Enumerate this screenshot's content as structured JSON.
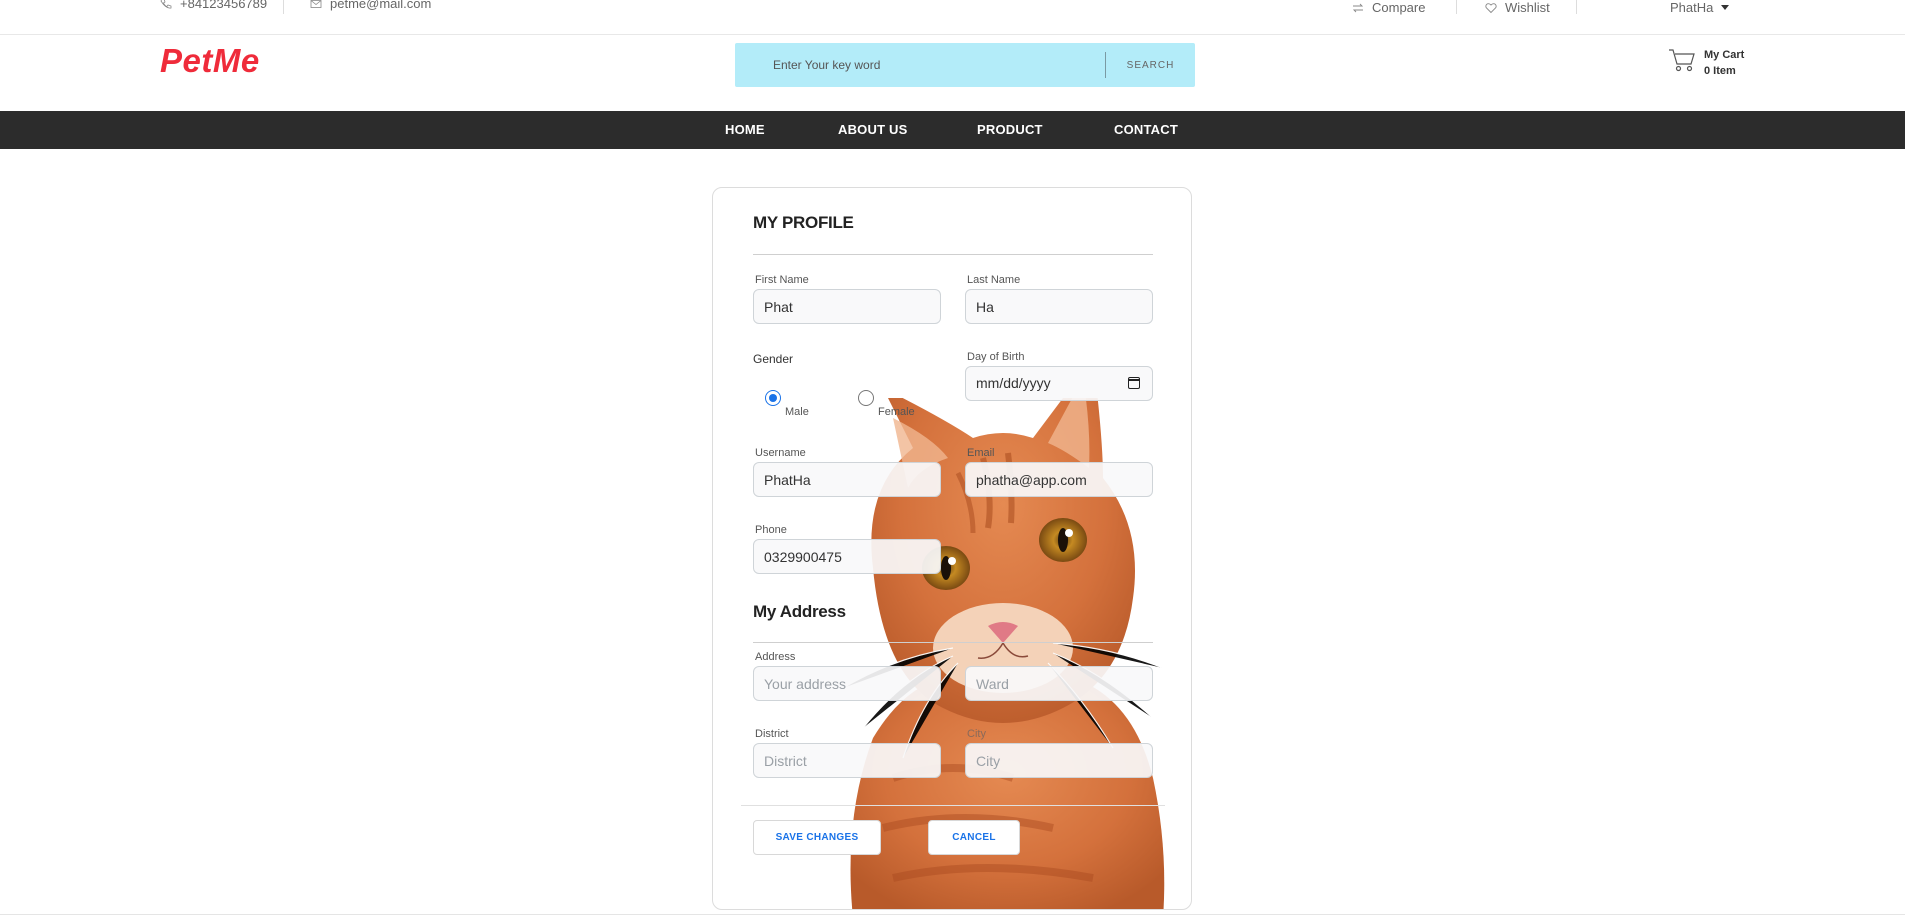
{
  "topbar": {
    "phone": "+84123456789",
    "email": "petme@mail.com",
    "compare": "Compare",
    "wishlist": "Wishlist",
    "user": "PhatHa"
  },
  "header": {
    "logo": "PetMe",
    "search_placeholder": "Enter Your key word",
    "search_button": "SEARCH",
    "cart_title": "My Cart",
    "cart_count": "0 Item"
  },
  "nav": {
    "items": [
      "HOME",
      "ABOUT US",
      "PRODUCT",
      "CONTACT"
    ]
  },
  "profile": {
    "title": "MY PROFILE",
    "first_name_label": "First Name",
    "first_name_value": "Phat",
    "last_name_label": "Last Name",
    "last_name_value": "Ha",
    "gender_label": "Gender",
    "gender_male": "Male",
    "gender_female": "Female",
    "gender_selected": "Male",
    "dob_label": "Day of Birth",
    "dob_placeholder": "mm/dd/yyyy",
    "username_label": "Username",
    "username_value": "PhatHa",
    "email_label": "Email",
    "email_value": "phatha@app.com",
    "phone_label": "Phone",
    "phone_value": "0329900475"
  },
  "address": {
    "title": "My Address",
    "address_label": "Address",
    "address_placeholder": "Your address",
    "ward_placeholder": "Ward",
    "district_label": "District",
    "district_placeholder": "District",
    "city_label": "City",
    "city_placeholder": "City"
  },
  "actions": {
    "save": "SAVE CHANGES",
    "cancel": "CANCEL"
  },
  "colors": {
    "brand": "#ef2b3a",
    "search_bg": "#b3ecf9",
    "nav_bg": "#2c2c2c",
    "link_blue": "#1a73e8"
  },
  "icons": [
    "phone-icon",
    "mail-icon",
    "compare-icon",
    "heart-icon",
    "caret-down-icon",
    "cart-icon",
    "calendar-icon"
  ]
}
